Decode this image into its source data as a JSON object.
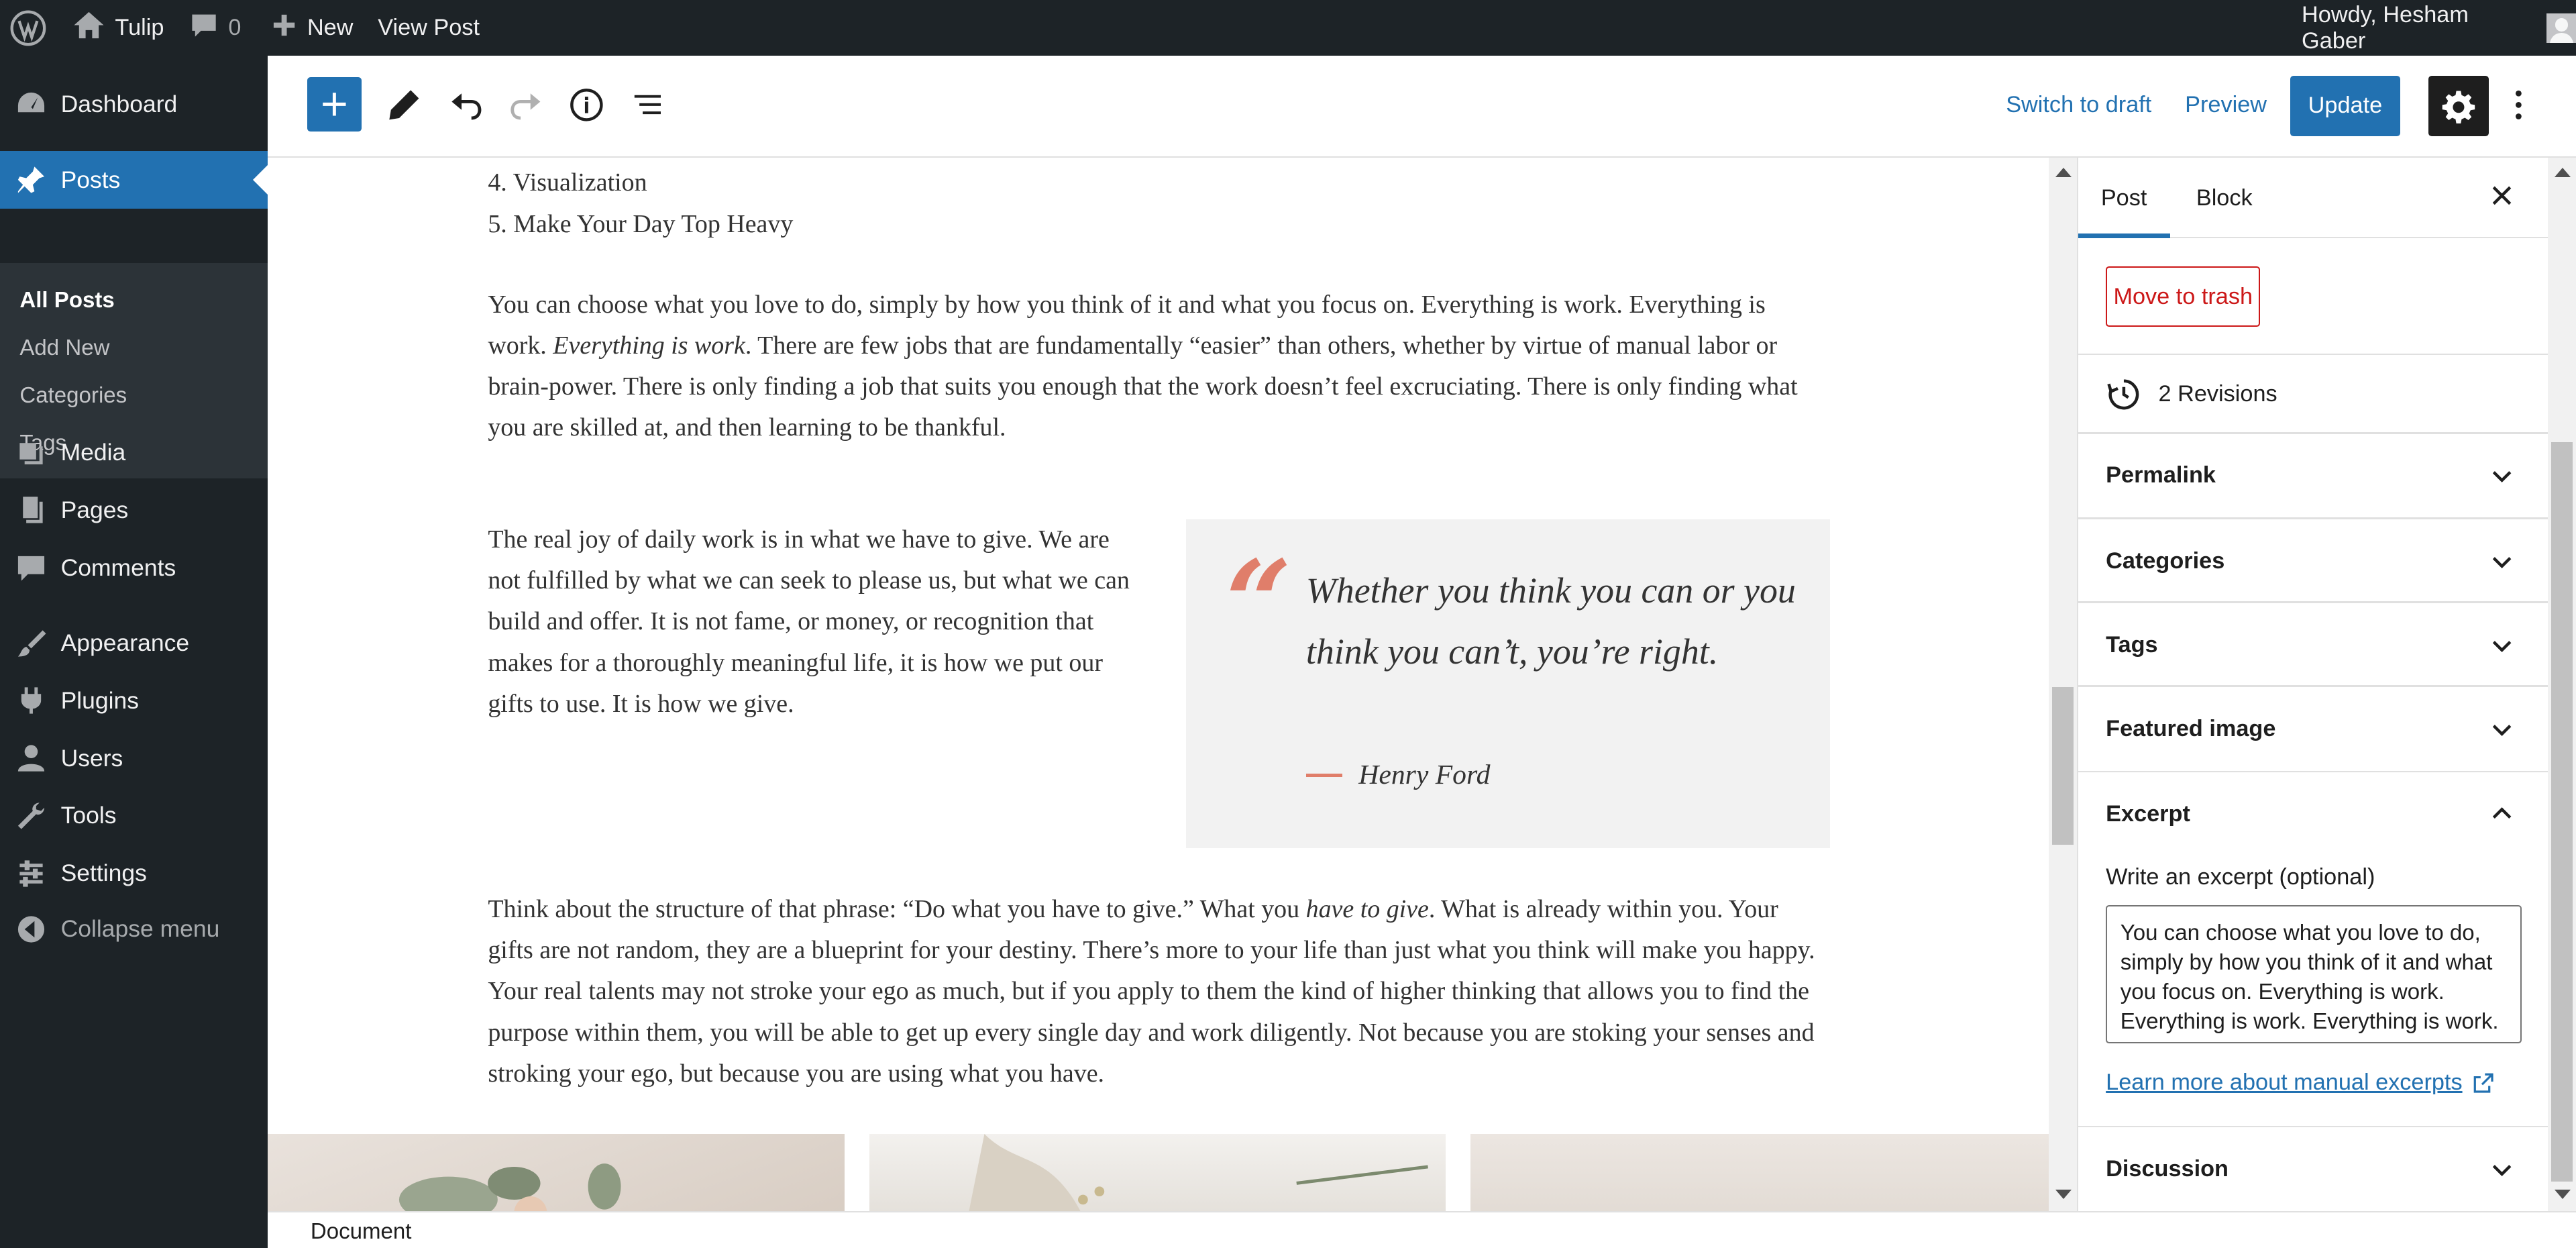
{
  "admin_bar": {
    "site_name": "Tulip",
    "comments_count": "0",
    "new_label": "New",
    "view_post_label": "View Post",
    "greeting": "Howdy, Hesham Gaber"
  },
  "sidebar": {
    "items": [
      {
        "label": "Dashboard",
        "icon": "dashboard-icon"
      },
      {
        "label": "Posts",
        "icon": "pin-icon",
        "active": true
      },
      {
        "label": "Media",
        "icon": "media-icon"
      },
      {
        "label": "Pages",
        "icon": "pages-icon"
      },
      {
        "label": "Comments",
        "icon": "comment-icon"
      },
      {
        "label": "Appearance",
        "icon": "brush-icon"
      },
      {
        "label": "Plugins",
        "icon": "plugin-icon"
      },
      {
        "label": "Users",
        "icon": "user-icon"
      },
      {
        "label": "Tools",
        "icon": "wrench-icon"
      },
      {
        "label": "Settings",
        "icon": "settings-sliders-icon"
      },
      {
        "label": "Collapse menu",
        "icon": "collapse-icon"
      }
    ],
    "submenu": [
      "All Posts",
      "Add New",
      "Categories",
      "Tags"
    ]
  },
  "header": {
    "switch_draft": "Switch to draft",
    "preview": "Preview",
    "update": "Update"
  },
  "content": {
    "list_items": [
      "Visualization",
      "Make Your Day Top Heavy"
    ],
    "para1_a": "You can choose what you love to do, simply by how you think of it and what you focus on. Everything is work. Everything is work. ",
    "para1_em": "Everything is work",
    "para1_b": ". There are few jobs that are fundamentally “easier” than others, whether by virtue of manual labor or brain-power. There is only finding a job that suits you enough that the work doesn’t feel excruciating. There is only finding what you are skilled at, and then learning to be thankful.",
    "col_text": "The real joy of daily work is in what we have to give. We are not fulfilled by what we can seek to please us, but what we can build and offer. It is not fame, or money, or recognition that makes for a thoroughly meaningful life, it is how we put our gifts to use. It is how we give.",
    "quote_text": "Whether you think you can or you think you can’t, you’re right.",
    "quote_cite": "Henry Ford",
    "para2_a": "Think about the structure of that phrase: “Do what you have to give.” What you ",
    "para2_em": "have to give",
    "para2_b": ". What is already within you. Your gifts are not random, they are a blueprint for your destiny. There’s more to your life than just what you think will make you happy. Your real talents may not stroke your ego as much, but if you apply to them the kind of higher thinking that allows you to find the purpose within them, you will be able to get up every single day and work diligently. Not because you are stoking your senses and stroking your ego, but because you are using what you have."
  },
  "settings_panel": {
    "tab_post": "Post",
    "tab_block": "Block",
    "move_to_trash": "Move to trash",
    "revisions": "2 Revisions",
    "panels": [
      "Permalink",
      "Categories",
      "Tags",
      "Featured image",
      "Excerpt",
      "Discussion"
    ],
    "excerpt_label": "Write an excerpt (optional)",
    "excerpt_value": "You can choose what you love to do, simply by how you think of it and what you focus on. Everything is work. Everything is work. Everything is work.",
    "learn_more": "Learn more about manual excerpts"
  },
  "footer": {
    "breadcrumb": "Document"
  },
  "colors": {
    "admin_dark": "#1d2327",
    "accent": "#2271b1",
    "quote_accent": "#e07e6a",
    "danger": "#cc1818"
  }
}
